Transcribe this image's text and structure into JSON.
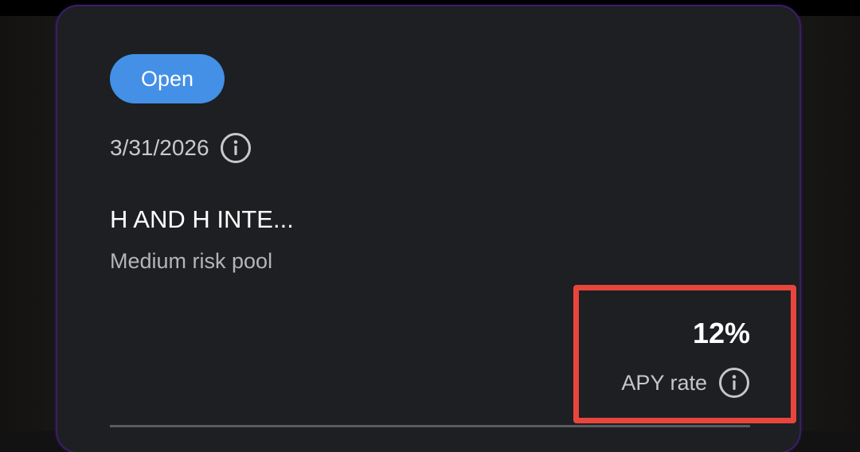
{
  "pool": {
    "status_badge": "Open",
    "date": "3/31/2026",
    "name": "H AND H INTE...",
    "risk_label": "Medium risk pool",
    "apy_value": "12%",
    "apy_label": "APY rate"
  },
  "icons": {
    "date_info": "info-circle-icon",
    "apy_info": "info-circle-icon"
  },
  "colors": {
    "badge_bg": "#4390e6",
    "card_bg": "#1d1f22",
    "highlight": "#e8453c"
  }
}
